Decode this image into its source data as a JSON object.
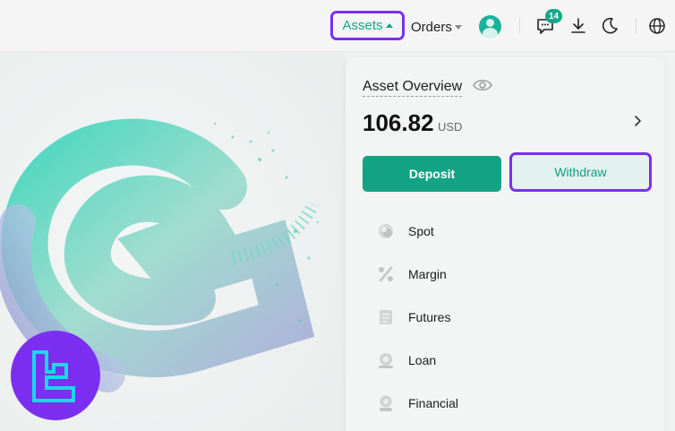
{
  "header": {
    "assets_label": "Assets",
    "orders_label": "Orders",
    "notifications_count": "14"
  },
  "panel": {
    "title": "Asset Overview",
    "balance": "106.82",
    "currency": "USD",
    "deposit_label": "Deposit",
    "withdraw_label": "Withdraw",
    "items": [
      {
        "label": "Spot",
        "icon": "spot-icon"
      },
      {
        "label": "Margin",
        "icon": "percent-icon"
      },
      {
        "label": "Futures",
        "icon": "document-icon"
      },
      {
        "label": "Loan",
        "icon": "loan-icon"
      },
      {
        "label": "Financial",
        "icon": "financial-icon"
      }
    ]
  },
  "colors": {
    "accent": "#13a68a",
    "highlight": "#7b2ff0",
    "background": "#f3f4f4"
  }
}
